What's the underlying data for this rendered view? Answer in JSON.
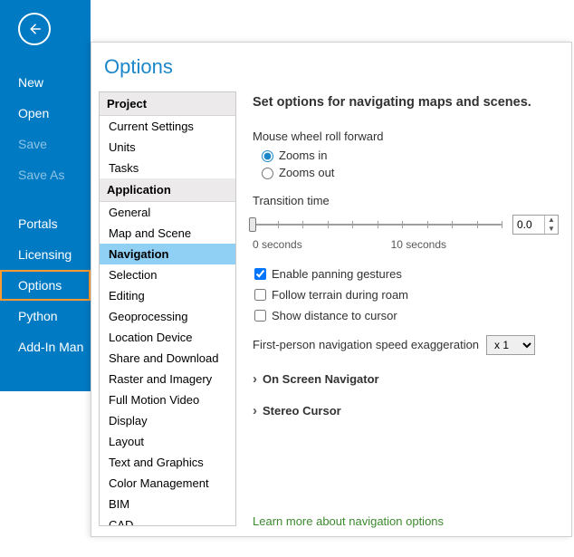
{
  "blue_sidebar": {
    "items": [
      {
        "label": "New",
        "state": "normal"
      },
      {
        "label": "Open",
        "state": "normal"
      },
      {
        "label": "Save",
        "state": "disabled"
      },
      {
        "label": "Save As",
        "state": "disabled"
      },
      {
        "label": "Portals",
        "state": "normal"
      },
      {
        "label": "Licensing",
        "state": "normal"
      },
      {
        "label": "Options",
        "state": "selected"
      },
      {
        "label": "Python",
        "state": "normal"
      },
      {
        "label": "Add-In Man",
        "state": "normal"
      }
    ]
  },
  "panel": {
    "title": "Options",
    "categories": {
      "headers": [
        "Project",
        "Application"
      ],
      "project_items": [
        "Current Settings",
        "Units",
        "Tasks"
      ],
      "application_items": [
        "General",
        "Map and Scene",
        "Navigation",
        "Selection",
        "Editing",
        "Geoprocessing",
        "Location Device",
        "Share and Download",
        "Raster and Imagery",
        "Full Motion Video",
        "Display",
        "Layout",
        "Text and Graphics",
        "Color Management",
        "BIM",
        "CAD"
      ],
      "selected": "Navigation"
    }
  },
  "settings": {
    "heading": "Set options for navigating maps and scenes.",
    "mouse_wheel": {
      "label": "Mouse wheel roll forward",
      "zooms_in": "Zooms in",
      "zooms_out": "Zooms out",
      "selected": "zooms_in"
    },
    "transition": {
      "label": "Transition time",
      "value": "0.0",
      "min_label": "0 seconds",
      "max_label": "10 seconds"
    },
    "checkboxes": {
      "panning": {
        "label": "Enable panning gestures",
        "checked": true
      },
      "terrain": {
        "label": "Follow terrain during roam",
        "checked": false
      },
      "distance": {
        "label": "Show distance to cursor",
        "checked": false
      }
    },
    "exaggeration": {
      "label": "First-person navigation speed exaggeration",
      "value": "x 1"
    },
    "collapsibles": [
      "On Screen Navigator",
      "Stereo Cursor"
    ],
    "learn_more": "Learn more about navigation options"
  }
}
